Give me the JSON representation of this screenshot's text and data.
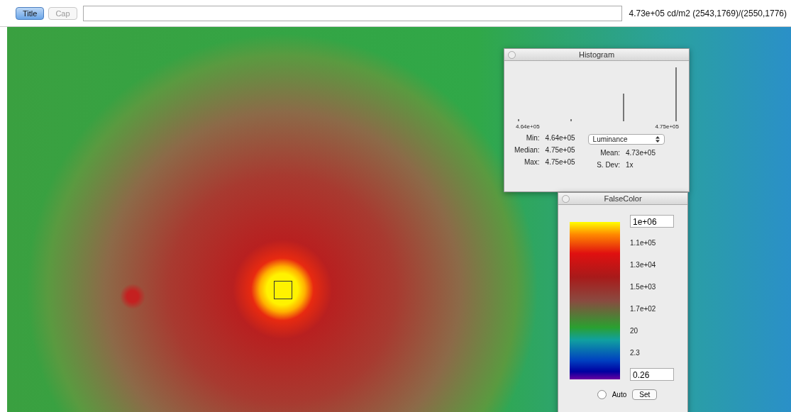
{
  "toolbar": {
    "buttons": [
      {
        "label": "Title",
        "selected": true
      },
      {
        "label": "Cap",
        "selected": false
      }
    ],
    "readout": "4.73e+05 cd/m2 (2543,1769)/(2550,1776)"
  },
  "histogram": {
    "title": "Histogram",
    "axis_min": "4.64e+05",
    "axis_max": "4.75e+05",
    "stats_left": [
      {
        "label": "Min:",
        "value": "4.64e+05"
      },
      {
        "label": "Median:",
        "value": "4.75e+05"
      },
      {
        "label": "Max:",
        "value": "4.75e+05"
      }
    ],
    "channel_select": "Luminance",
    "stats_right": [
      {
        "label": "Mean:",
        "value": "4.73e+05"
      },
      {
        "label": "S. Dev:",
        "value": "1x"
      }
    ]
  },
  "false_color": {
    "title": "FalseColor",
    "max_field": "1e+06",
    "scale_labels": [
      "1.1e+05",
      "1.3e+04",
      "1.5e+03",
      "1.7e+02",
      "20",
      "2.3"
    ],
    "min_field": "0.26",
    "auto": {
      "label": "Auto",
      "checked": false
    },
    "set_button": "Set"
  }
}
